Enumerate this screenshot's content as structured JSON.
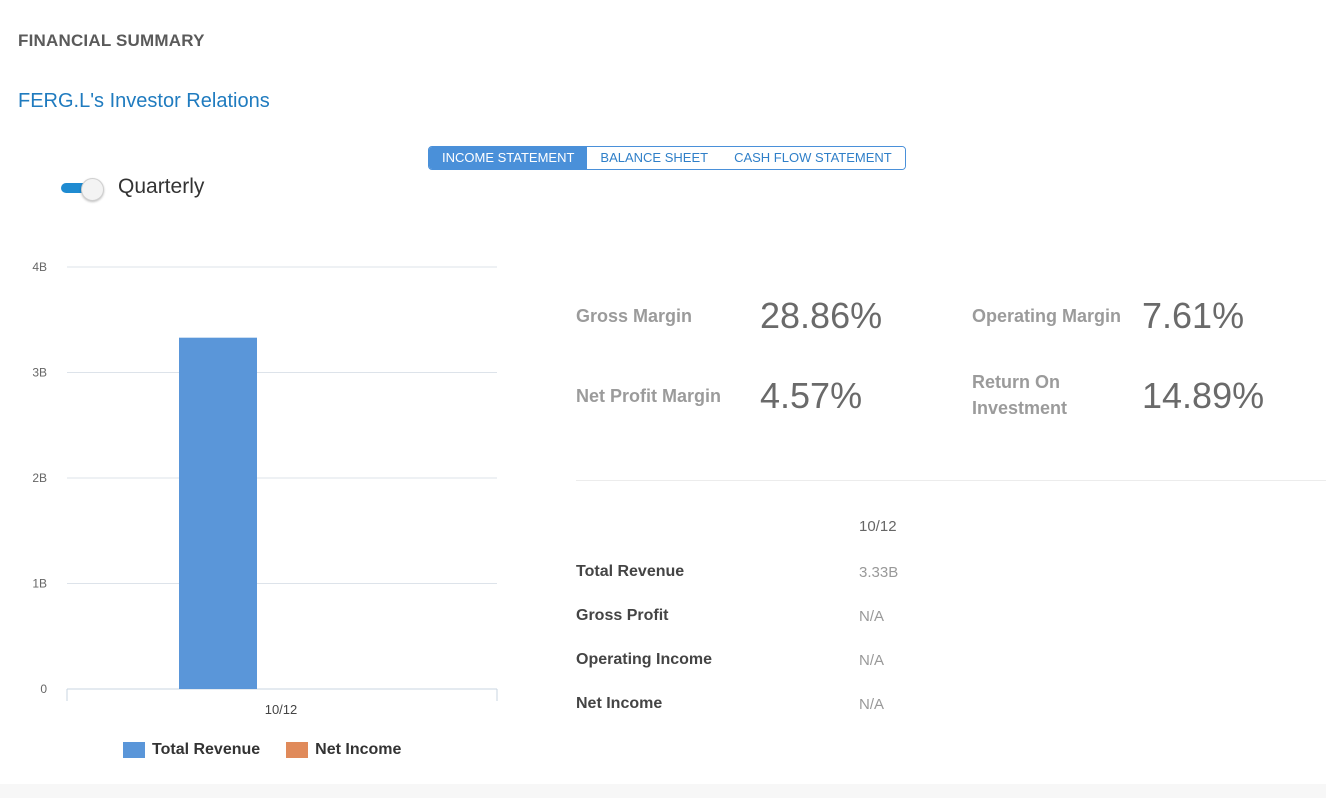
{
  "header": {
    "section_title": "FINANCIAL SUMMARY",
    "ir_link": "FERG.L's Investor Relations"
  },
  "tabs": [
    {
      "label": "INCOME STATEMENT",
      "active": true
    },
    {
      "label": "BALANCE SHEET",
      "active": false
    },
    {
      "label": "CASH FLOW STATEMENT",
      "active": false
    }
  ],
  "toggle": {
    "label": "Quarterly",
    "on": true
  },
  "chart_data": {
    "type": "bar",
    "categories": [
      "10/12"
    ],
    "series": [
      {
        "name": "Total Revenue",
        "values": [
          3.33
        ],
        "color": "#5a96d9"
      },
      {
        "name": "Net Income",
        "values": [
          null
        ],
        "color": "#e08a5a"
      }
    ],
    "y_ticks": [
      "0",
      "1B",
      "2B",
      "3B",
      "4B"
    ],
    "ylim": [
      0,
      4
    ],
    "grid": true,
    "legend_position": "bottom"
  },
  "metrics": {
    "gross_margin": {
      "label": "Gross Margin",
      "value": "28.86%"
    },
    "operating_margin": {
      "label": "Operating Margin",
      "value": "7.61%"
    },
    "net_profit_margin": {
      "label": "Net Profit Margin",
      "value": "4.57%"
    },
    "return_on_investment": {
      "label_line1": "Return On",
      "label_line2": "Investment",
      "value": "14.89%"
    }
  },
  "table": {
    "column": "10/12",
    "rows": [
      {
        "label": "Total Revenue",
        "value": "3.33B"
      },
      {
        "label": "Gross Profit",
        "value": "N/A"
      },
      {
        "label": "Operating Income",
        "value": "N/A"
      },
      {
        "label": "Net Income",
        "value": "N/A"
      }
    ]
  }
}
